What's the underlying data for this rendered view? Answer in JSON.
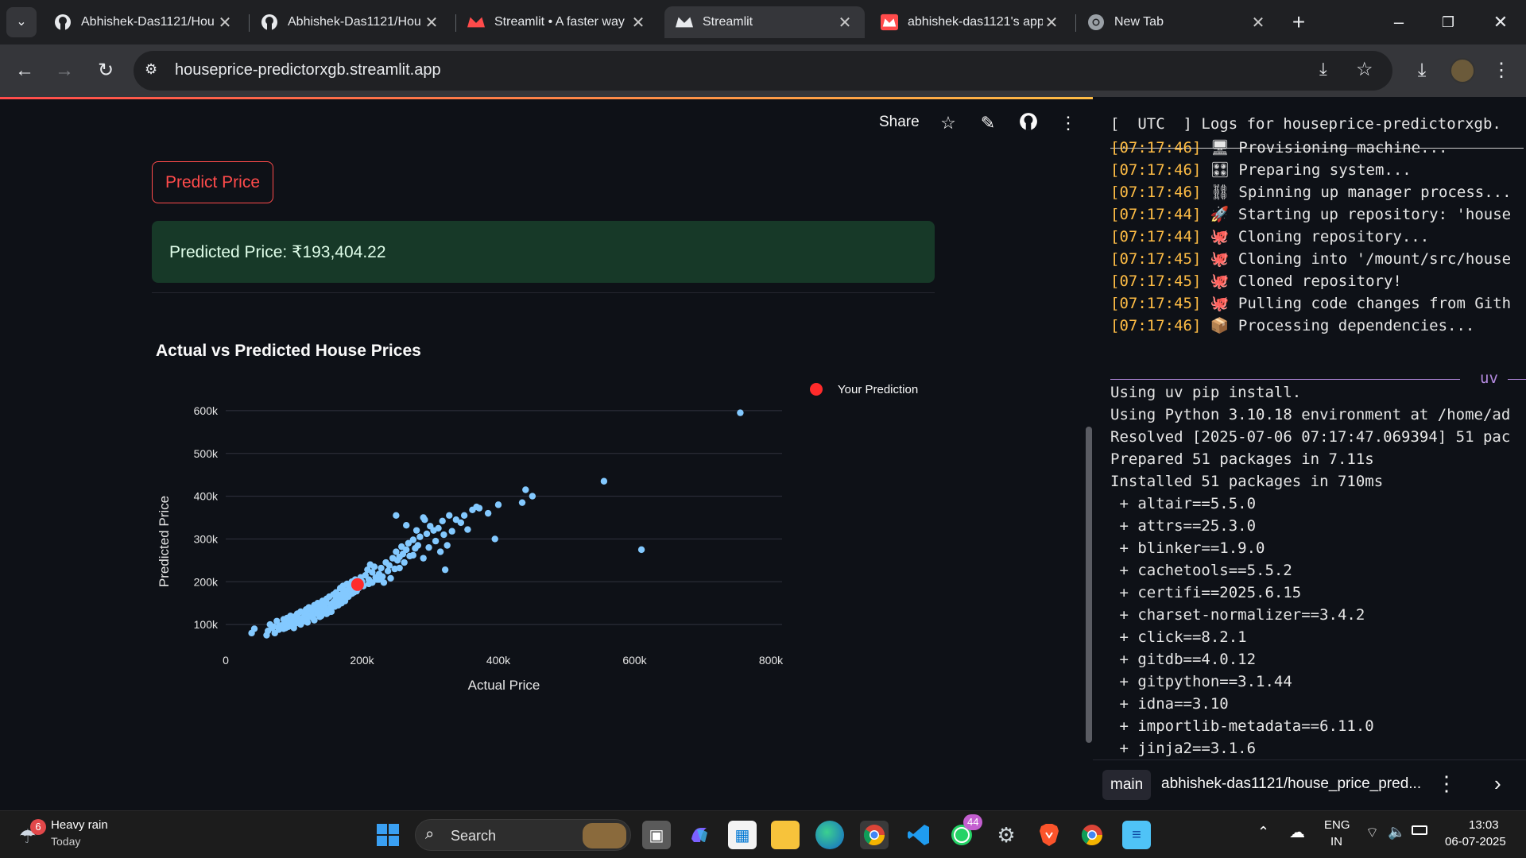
{
  "browser": {
    "tabs": [
      {
        "title": "Abhishek-Das1121/Hou",
        "icon": "github-icon"
      },
      {
        "title": "Abhishek-Das1121/Hou",
        "icon": "github-icon"
      },
      {
        "title": "Streamlit • A faster way",
        "icon": "streamlit-icon"
      },
      {
        "title": "Streamlit",
        "icon": "streamlit-icon"
      },
      {
        "title": "abhishek-das1121's app",
        "icon": "streamlit-icon"
      },
      {
        "title": "New Tab",
        "icon": "chrome-icon"
      }
    ],
    "url": "houseprice-predictorxgb.streamlit.app",
    "colors": {
      "tab_strip": "#1f2023",
      "toolbar": "#35363a",
      "active_tab": "#35363a"
    }
  },
  "app": {
    "share_label": "Share",
    "predict_button": "Predict Price",
    "prediction_text": "Predicted Price: ₹193,404.22",
    "chart_title": "Actual vs Predicted House Prices",
    "colors": {
      "accent": "#ff4b4b",
      "success_bg": "#173928",
      "points": "#83c9ff",
      "prediction": "#ff2b2b"
    }
  },
  "chart_data": {
    "type": "scatter",
    "title": "Actual vs Predicted House Prices",
    "xlabel": "Actual Price",
    "ylabel": "Predicted Price",
    "xlim": [
      0,
      800000
    ],
    "ylim": [
      50000,
      650000
    ],
    "xticks": [
      "0",
      "200k",
      "400k",
      "600k",
      "800k"
    ],
    "yticks": [
      "100k",
      "200k",
      "300k",
      "400k",
      "500k",
      "600k"
    ],
    "ytick_values": [
      100000,
      200000,
      300000,
      400000,
      500000,
      600000
    ],
    "xtick_values": [
      0,
      200000,
      400000,
      600000,
      800000
    ],
    "legend": {
      "position": "top-right",
      "label": "Your Prediction"
    },
    "grid": "horizontal",
    "series": [
      {
        "values": [
          [
            38000,
            80000
          ],
          [
            42000,
            90000
          ],
          [
            60000,
            75000
          ],
          [
            62000,
            85000
          ],
          [
            65000,
            100000
          ],
          [
            70000,
            95000
          ],
          [
            75000,
            108000
          ],
          [
            78000,
            88000
          ],
          [
            82000,
            98000
          ],
          [
            85000,
            112000
          ],
          [
            88000,
            105000
          ],
          [
            90000,
            115000
          ],
          [
            92000,
            95000
          ],
          [
            95000,
            120000
          ],
          [
            98000,
            108000
          ],
          [
            100000,
            118000
          ],
          [
            102000,
            102000
          ],
          [
            105000,
            125000
          ],
          [
            108000,
            115000
          ],
          [
            110000,
            130000
          ],
          [
            112000,
            110000
          ],
          [
            115000,
            128000
          ],
          [
            118000,
            135000
          ],
          [
            120000,
            122000
          ],
          [
            122000,
            140000
          ],
          [
            125000,
            118000
          ],
          [
            128000,
            132000
          ],
          [
            130000,
            145000
          ],
          [
            132000,
            126000
          ],
          [
            135000,
            150000
          ],
          [
            138000,
            138000
          ],
          [
            140000,
            128000
          ],
          [
            142000,
            155000
          ],
          [
            145000,
            142000
          ],
          [
            148000,
            160000
          ],
          [
            150000,
            135000
          ],
          [
            152000,
            165000
          ],
          [
            155000,
            148000
          ],
          [
            158000,
            170000
          ],
          [
            160000,
            155000
          ],
          [
            162000,
            175000
          ],
          [
            165000,
            162000
          ],
          [
            168000,
            185000
          ],
          [
            170000,
            170000
          ],
          [
            172000,
            190000
          ],
          [
            175000,
            178000
          ],
          [
            178000,
            195000
          ],
          [
            180000,
            182000
          ],
          [
            185000,
            200000
          ],
          [
            188000,
            175000
          ],
          [
            190000,
            205000
          ],
          [
            195000,
            192000
          ],
          [
            198000,
            210000
          ],
          [
            200000,
            200000
          ],
          [
            205000,
            215000
          ],
          [
            208000,
            228000
          ],
          [
            210000,
            195000
          ],
          [
            212000,
            240000
          ],
          [
            215000,
            222000
          ],
          [
            218000,
            235000
          ],
          [
            222000,
            205000
          ],
          [
            225000,
            218000
          ],
          [
            228000,
            232000
          ],
          [
            230000,
            212000
          ],
          [
            235000,
            245000
          ],
          [
            238000,
            225000
          ],
          [
            240000,
            238000
          ],
          [
            245000,
            255000
          ],
          [
            248000,
            230000
          ],
          [
            250000,
            270000
          ],
          [
            252000,
            250000
          ],
          [
            255000,
            258000
          ],
          [
            258000,
            282000
          ],
          [
            260000,
            265000
          ],
          [
            262000,
            245000
          ],
          [
            265000,
            275000
          ],
          [
            268000,
            290000
          ],
          [
            270000,
            260000
          ],
          [
            275000,
            298000
          ],
          [
            278000,
            278000
          ],
          [
            280000,
            320000
          ],
          [
            282000,
            285000
          ],
          [
            285000,
            305000
          ],
          [
            290000,
            255000
          ],
          [
            292000,
            345000
          ],
          [
            295000,
            312000
          ],
          [
            300000,
            330000
          ],
          [
            305000,
            320000
          ],
          [
            308000,
            295000
          ],
          [
            312000,
            325000
          ],
          [
            315000,
            270000
          ],
          [
            318000,
            342000
          ],
          [
            320000,
            310000
          ],
          [
            322000,
            228000
          ],
          [
            325000,
            285000
          ],
          [
            328000,
            355000
          ],
          [
            332000,
            318000
          ],
          [
            338000,
            345000
          ],
          [
            345000,
            338000
          ],
          [
            350000,
            355000
          ],
          [
            355000,
            322000
          ],
          [
            362000,
            368000
          ],
          [
            368000,
            375000
          ],
          [
            372000,
            372000
          ],
          [
            385000,
            360000
          ],
          [
            395000,
            300000
          ],
          [
            400000,
            380000
          ],
          [
            435000,
            385000
          ],
          [
            440000,
            415000
          ],
          [
            450000,
            400000
          ],
          [
            555000,
            435000
          ],
          [
            610000,
            275000
          ],
          [
            755000,
            595000
          ],
          [
            250000,
            355000
          ],
          [
            290000,
            350000
          ],
          [
            265000,
            332000
          ],
          [
            232000,
            198000
          ],
          [
            242000,
            208000
          ],
          [
            255000,
            232000
          ],
          [
            275000,
            262000
          ],
          [
            298000,
            280000
          ],
          [
            180000,
            165000
          ],
          [
            170000,
            150000
          ],
          [
            160000,
            142000
          ],
          [
            150000,
            128000
          ],
          [
            140000,
            120000
          ],
          [
            130000,
            110000
          ],
          [
            120000,
            105000
          ],
          [
            110000,
            100000
          ],
          [
            100000,
            92000
          ],
          [
            85000,
            90000
          ],
          [
            72000,
            80000
          ],
          [
            95000,
            105000
          ],
          [
            105000,
            112000
          ],
          [
            115000,
            118000
          ],
          [
            125000,
            128000
          ],
          [
            135000,
            132000
          ],
          [
            145000,
            140000
          ],
          [
            155000,
            142000
          ],
          [
            165000,
            158000
          ],
          [
            175000,
            165000
          ],
          [
            185000,
            172000
          ],
          [
            195000,
            185000
          ],
          [
            202000,
            190000
          ],
          [
            215000,
            198000
          ],
          [
            225000,
            205000
          ],
          [
            155000,
            130000
          ],
          [
            148000,
            125000
          ],
          [
            138000,
            118000
          ],
          [
            128000,
            115000
          ],
          [
            118000,
            112000
          ],
          [
            108000,
            108000
          ],
          [
            98000,
            98000
          ],
          [
            88000,
            92000
          ],
          [
            78000,
            95000
          ],
          [
            68000,
            92000
          ],
          [
            158000,
            152000
          ],
          [
            168000,
            160000
          ],
          [
            178000,
            168000
          ],
          [
            188000,
            180000
          ],
          [
            192000,
            178000
          ],
          [
            175000,
            155000
          ],
          [
            165000,
            145000
          ],
          [
            145000,
            130000
          ],
          [
            135000,
            125000
          ],
          [
            125000,
            122000
          ],
          [
            115000,
            108000
          ],
          [
            105000,
            105000
          ],
          [
            118000,
            125000
          ],
          [
            128000,
            138000
          ],
          [
            138000,
            145000
          ],
          [
            148000,
            150000
          ],
          [
            162000,
            165000
          ],
          [
            172000,
            172000
          ],
          [
            182000,
            188000
          ],
          [
            192000,
            198000
          ],
          [
            210000,
            205000
          ],
          [
            220000,
            210000
          ]
        ]
      },
      {
        "name": "Your Prediction",
        "values": [
          [
            193404,
            193404
          ]
        ]
      }
    ]
  },
  "logs": {
    "header": "[  UTC  ] Logs for houseprice-predictorxgb.",
    "lines": [
      {
        "ts": "[07:17:46]",
        "text": " 🖥 Provisioning machine..."
      },
      {
        "ts": "[07:17:46]",
        "text": " 🎛 Preparing system..."
      },
      {
        "ts": "[07:17:46]",
        "text": " ⛓ Spinning up manager process..."
      },
      {
        "ts": "[07:17:44]",
        "text": " 🚀 Starting up repository: 'house"
      },
      {
        "ts": "[07:17:44]",
        "text": " 🐙 Cloning repository..."
      },
      {
        "ts": "[07:17:45]",
        "text": " 🐙 Cloning into '/mount/src/house"
      },
      {
        "ts": "[07:17:45]",
        "text": " 🐙 Cloned repository!"
      },
      {
        "ts": "[07:17:45]",
        "text": " 🐙 Pulling code changes from Gith"
      },
      {
        "ts": "[07:17:46]",
        "text": " 📦 Processing dependencies..."
      }
    ],
    "uv_label": "uv",
    "output": [
      "Using uv pip install.",
      "Using Python 3.10.18 environment at /home/ad",
      "Resolved [2025-07-06 07:17:47.069394] 51 pac",
      "Prepared 51 packages in 7.11s",
      "Installed 51 packages in 710ms",
      " + altair==5.5.0",
      " + attrs==25.3.0",
      " + blinker==1.9.0",
      " + cachetools==5.5.2",
      " + certifi==2025.6.15",
      " + charset-normalizer==3.4.2",
      " + click==8.2.1",
      " + gitdb==4.0.12",
      " + gitpython==3.1.44",
      " + idna==3.10",
      " + importlib-metadata==6.11.0",
      " + jinja2==3.1.6"
    ],
    "branch": "main",
    "repo": "abhishek-das1121/house_price_pred..."
  },
  "taskbar": {
    "weather_badge": "6",
    "weather_title": "Heavy rain",
    "weather_sub": "Today",
    "search_placeholder": "Search",
    "whatsapp_badge": "44",
    "lang": "ENG",
    "region": "IN",
    "time": "13:03",
    "date": "06-07-2025"
  }
}
